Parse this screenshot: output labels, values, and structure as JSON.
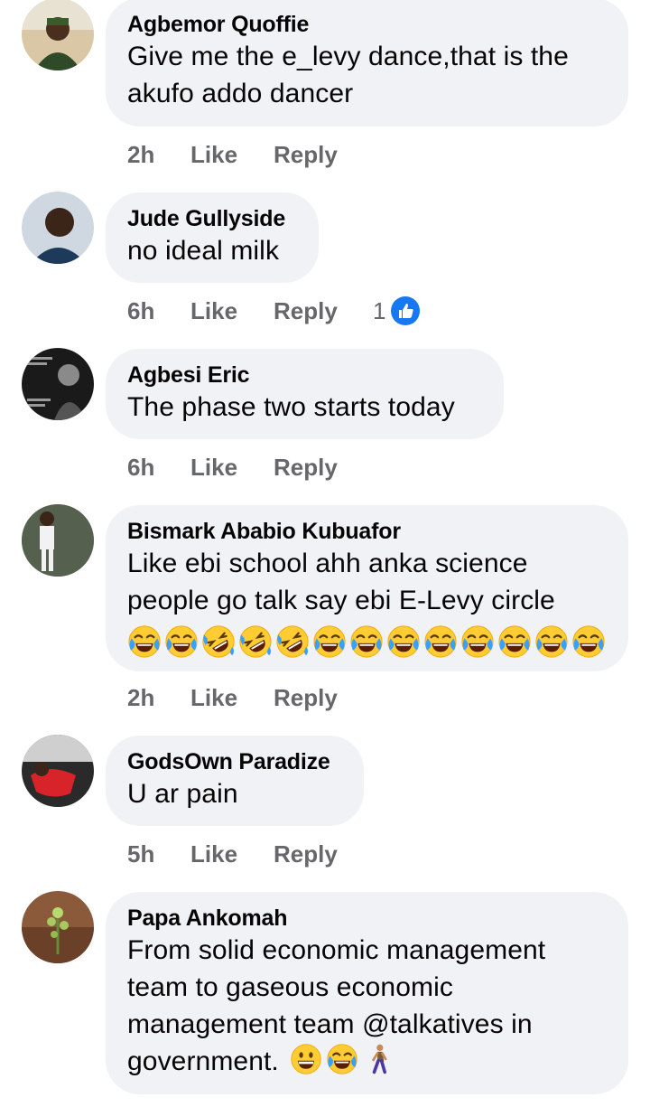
{
  "comments": [
    {
      "author": "Agbemor Quoffie",
      "text_lines": [
        "Give me the e_levy dance,that is the",
        "akufo addo dancer"
      ],
      "time": "2h",
      "like": "Like",
      "reply": "Reply"
    },
    {
      "author": "Jude Gullyside",
      "text_lines": [
        "no ideal milk"
      ],
      "time": "6h",
      "like": "Like",
      "reply": "Reply",
      "reaction_count": "1"
    },
    {
      "author": "Agbesi Eric",
      "text_lines": [
        "The phase two starts today"
      ],
      "time": "6h",
      "like": "Like",
      "reply": "Reply"
    },
    {
      "author": "Bismark Ababio Kubuafor",
      "text_lines": [
        "Like ebi school ahh anka science",
        "people go talk say ebi E-Levy circle"
      ],
      "emojis": [
        "joy",
        "joy",
        "rofl",
        "rofl",
        "rofl",
        "joy",
        "joy",
        "joy",
        "joy",
        "joy",
        "joy",
        "joy",
        "joy"
      ],
      "time": "2h",
      "like": "Like",
      "reply": "Reply"
    },
    {
      "author": "GodsOwn Paradize",
      "text_lines": [
        "U ar pain"
      ],
      "time": "5h",
      "like": "Like",
      "reply": "Reply"
    },
    {
      "author": "Papa Ankomah",
      "text_lines": [
        "From solid economic management",
        "team to gaseous economic",
        "management team @talkatives in",
        "government."
      ],
      "trailing_emojis": [
        "grinning",
        "joy",
        "person-walking"
      ]
    }
  ],
  "colors": {
    "bubble": "#f0f2f5",
    "meta": "#65676b",
    "like_badge": "#1877f2"
  }
}
